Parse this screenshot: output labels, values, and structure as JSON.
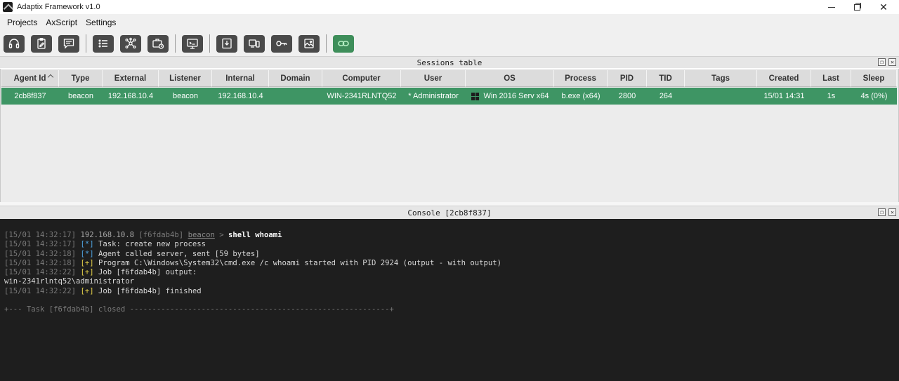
{
  "window": {
    "title": "Adaptix Framework v1.0"
  },
  "menu": {
    "items": [
      "Projects",
      "AxScript",
      "Settings"
    ]
  },
  "toolbar": {
    "buttons": [
      {
        "icon": "headset-icon"
      },
      {
        "icon": "clipboard-edit-icon"
      },
      {
        "icon": "chat-message-icon"
      },
      {
        "icon": "list-icon"
      },
      {
        "icon": "network-graph-icon"
      },
      {
        "icon": "briefcase-clock-icon"
      },
      {
        "icon": "monitor-code-icon"
      },
      {
        "icon": "download-tray-icon"
      },
      {
        "icon": "devices-icon"
      },
      {
        "icon": "key-icon"
      },
      {
        "icon": "image-gallery-icon"
      },
      {
        "icon": "link-icon",
        "accent": "#3e8e5a"
      }
    ]
  },
  "sessions": {
    "title": "Sessions table",
    "columns": [
      "Agent Id",
      "Type",
      "External",
      "Listener",
      "Internal",
      "Domain",
      "Computer",
      "User",
      "OS",
      "Process",
      "PID",
      "TID",
      "Tags",
      "Created",
      "Last",
      "Sleep"
    ],
    "rows": [
      {
        "agent_id": "2cb8f837",
        "type": "beacon",
        "external": "192.168.10.4",
        "listener": "beacon",
        "internal": "192.168.10.4",
        "domain": "",
        "computer": "WIN-2341RLNTQ52",
        "user": "* Administrator",
        "os": "Win 2016 Serv x64",
        "process": "b.exe (x64)",
        "pid": "2800",
        "tid": "264",
        "tags": "",
        "created": "15/01 14:31",
        "last": "1s",
        "sleep": "4s (0%)"
      }
    ],
    "row_color": "#3e9564"
  },
  "console": {
    "title": "Console [2cb8f837]",
    "prompt": {
      "ts": "[15/01 14:32:17]",
      "ip": "192.168.10.8",
      "id": "[f6fdab4b]",
      "agent": "beacon",
      "arrow": ">",
      "command": "shell whoami"
    },
    "lines": [
      {
        "ts": "[15/01 14:32:17]",
        "tag": "[*]",
        "kind": "info",
        "text": "Task: create new process"
      },
      {
        "ts": "[15/01 14:32:18]",
        "tag": "[*]",
        "kind": "info",
        "text": "Agent called server, sent [59 bytes]"
      },
      {
        "ts": "[15/01 14:32:18]",
        "tag": "[+]",
        "kind": "ok",
        "text": "Program C:\\Windows\\System32\\cmd.exe /c whoami started with PID 2924 (output - with output)"
      },
      {
        "ts": "[15/01 14:32:22]",
        "tag": "[+]",
        "kind": "ok",
        "text": "Job [f6fdab4b] output:"
      },
      {
        "ts": "",
        "tag": "",
        "kind": "plain",
        "text": "win-2341rlntq52\\administrator"
      },
      {
        "ts": "[15/01 14:32:22]",
        "tag": "[+]",
        "kind": "ok",
        "text": "Job [f6fdab4b] finished"
      }
    ],
    "footer": "+--- Task [f6fdab4b] closed ----------------------------------------------------------+"
  }
}
